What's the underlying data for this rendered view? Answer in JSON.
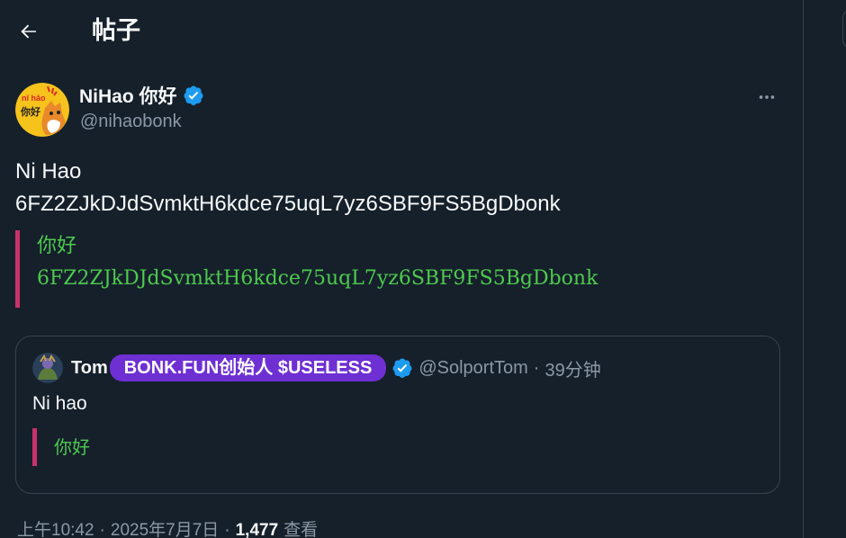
{
  "header": {
    "title": "帖子",
    "back_icon": "arrow-left-icon"
  },
  "post": {
    "author": {
      "display_name": "NiHao 你好",
      "handle": "@nihaobonk",
      "verified": true,
      "avatar_text_top": "nǐ hǎo",
      "avatar_text_bottom": "你好",
      "avatar_bg": "#f6c21c"
    },
    "text_lines": [
      "Ni Hao",
      "6FZ2ZJkDJdSvmktH6kdce75uqL7yz6SBF9FS5BgDbonk"
    ],
    "quote_lines": [
      "你好",
      "6FZ2ZJkDJdSvmktH6kdce75uqL7yz6SBF9FS5BgDbonk"
    ],
    "more_icon": "more-horizontal-icon"
  },
  "quoted_post": {
    "name": "Tom",
    "badge": "BONK.FUN创始人 $USELESS",
    "verified": true,
    "handle": "@SolportTom",
    "separator": "·",
    "time": "39分钟",
    "text": "Ni hao",
    "quote_line": "你好"
  },
  "meta": {
    "time": "上午10:42",
    "separator": "·",
    "date": "2025年7月7日",
    "views_count": "1,477",
    "views_label": "查看"
  },
  "colors": {
    "background": "#15202b",
    "border": "#38444d",
    "verified_blue": "#1d9bf0",
    "quote_bar": "#c8326c",
    "quote_text": "#4ec94e",
    "badge_purple": "#6e2fd3",
    "secondary_text": "#8b98a5"
  }
}
